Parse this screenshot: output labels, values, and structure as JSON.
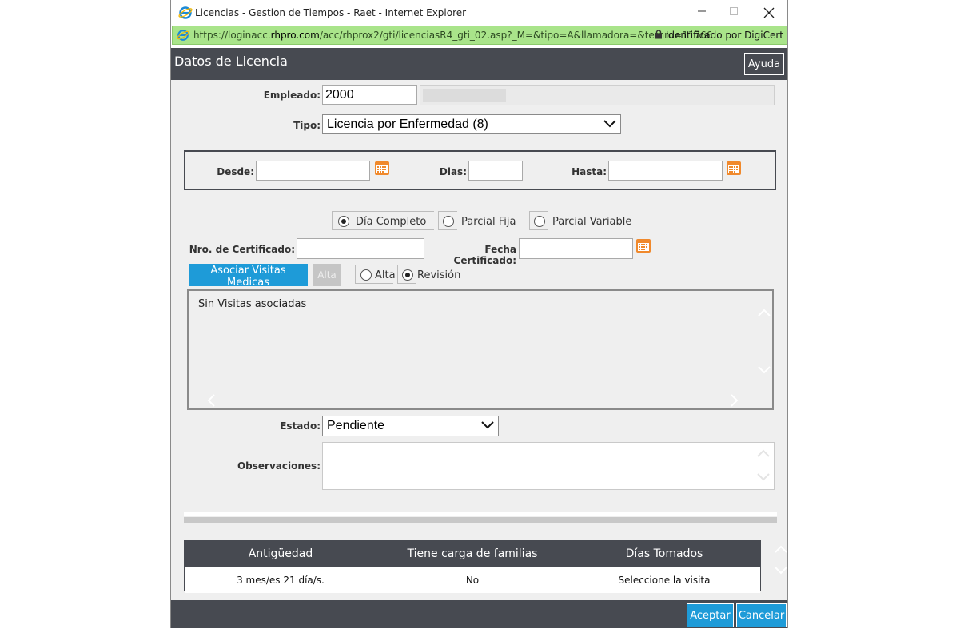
{
  "window": {
    "title": "Licencias - Gestion de Tiempos - Raet - Internet Explorer",
    "url_prefix": "https://loginacc.",
    "url_domain": "rhpro.com",
    "url_rest": "/acc/rhprox2/gti/licenciasR4_gti_02.asp?_M=&tipo=A&llamadora=&ternro=11766",
    "certificate": "Identificado por DigiCert"
  },
  "dialog": {
    "title": "Datos de Licencia",
    "help_label": "Ayuda"
  },
  "form": {
    "empleado_label": "Empleado:",
    "empleado_value": "2000",
    "tipo_label": "Tipo:",
    "tipo_value": "Licencia por Enfermedad (8)",
    "desde_label": "Desde:",
    "desde_value": "",
    "dias_label": "Dias:",
    "dias_value": "",
    "hasta_label": "Hasta:",
    "hasta_value": "",
    "dia_completo_label": "Día Completo",
    "parcial_fija_label": "Parcial Fija",
    "parcial_variable_label": "Parcial Variable",
    "jornada_selected": "dia_completo",
    "nro_certificado_label": "Nro. de Certificado:",
    "nro_certificado_value": "",
    "fecha_certificado_label": "Fecha Certificado:",
    "fecha_certificado_value": "",
    "asociar_label": "Asociar Visitas Medicas",
    "alta_button_label": "Alta",
    "alta_radio_label": "Alta",
    "revision_radio_label": "Revisión",
    "visita_selected": "revision",
    "visitas_empty_text": "Sin Visitas asociadas",
    "estado_label": "Estado:",
    "estado_value": "Pendiente",
    "observaciones_label": "Observaciones:",
    "observaciones_value": ""
  },
  "summary": {
    "headers": [
      "Antigüedad",
      "Tiene carga de familias",
      "Días Tomados"
    ],
    "row": [
      "3 mes/es 21 día/s.",
      "No",
      "Seleccione la visita"
    ]
  },
  "footer": {
    "accept_label": "Aceptar",
    "cancel_label": "Cancelar"
  },
  "colors": {
    "header_bg": "#474a51",
    "accent_blue": "#1e9bd8",
    "address_green": "#a9e48a",
    "calendar_orange": "#f0892c"
  },
  "icons": {
    "browser": "internet-explorer-icon",
    "lock": "lock-icon",
    "calendar": "calendar-icon"
  }
}
